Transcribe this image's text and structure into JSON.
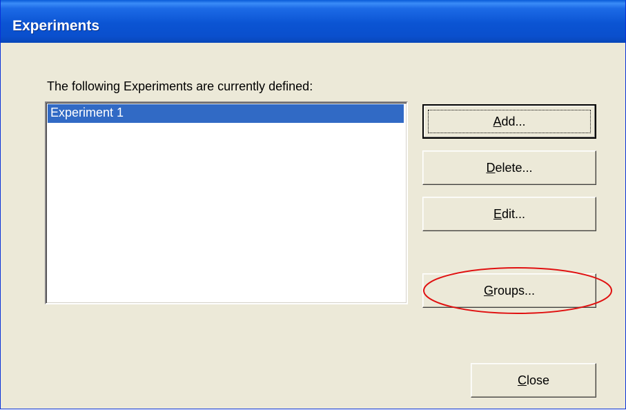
{
  "window": {
    "title": "Experiments"
  },
  "dialog": {
    "prompt": "The following Experiments are currently defined:",
    "experiments": [
      {
        "label": "Experiment 1",
        "selected": true
      }
    ]
  },
  "buttons": {
    "add": {
      "mnemonic": "A",
      "rest": "dd..."
    },
    "delete": {
      "mnemonic": "D",
      "rest": "elete..."
    },
    "edit": {
      "mnemonic": "E",
      "rest": "dit..."
    },
    "groups": {
      "mnemonic": "G",
      "rest": "roups..."
    },
    "close": {
      "mnemonic": "C",
      "rest": "lose"
    }
  },
  "colors": {
    "selection": "#316ac5",
    "annotation_ellipse": "#e01010"
  }
}
